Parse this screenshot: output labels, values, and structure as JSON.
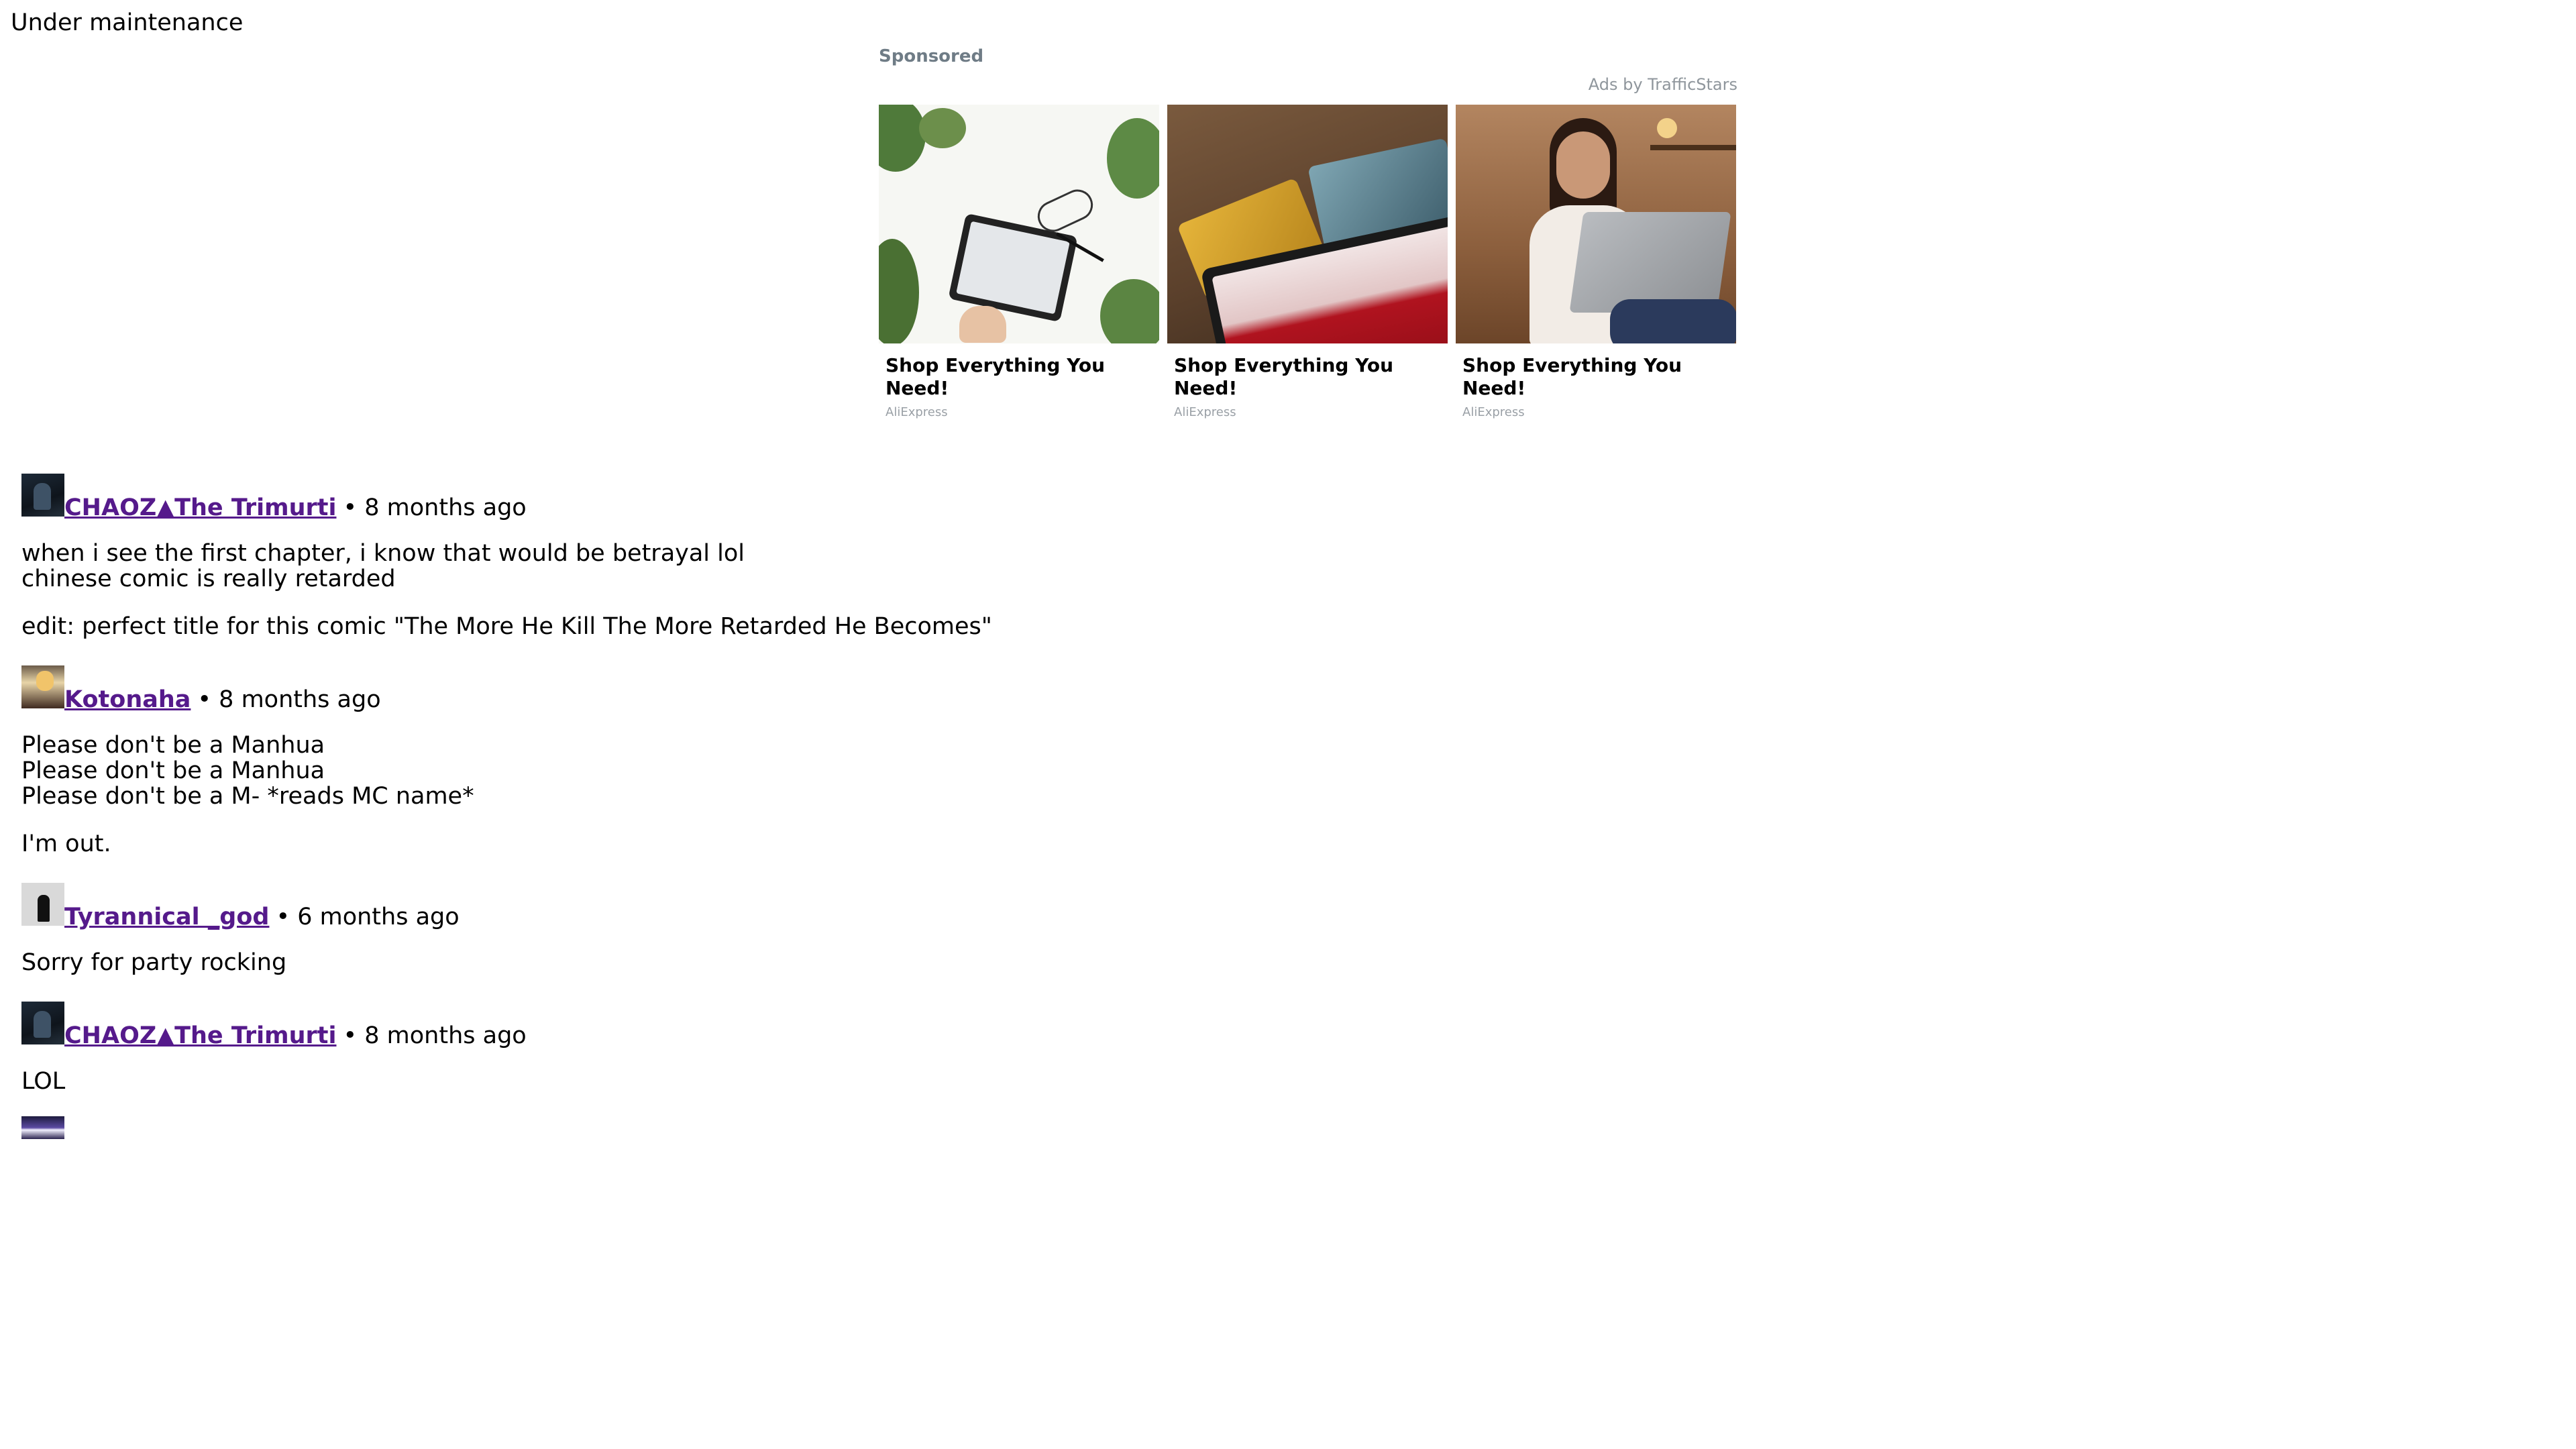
{
  "notice": "Under maintenance",
  "ads": {
    "sponsored_label": "Sponsored",
    "provider_label": "Ads by TrafficStars",
    "cards": [
      {
        "title": "Shop Everything You Need!",
        "source": "AliExpress"
      },
      {
        "title": "Shop Everything You Need!",
        "source": "AliExpress"
      },
      {
        "title": "Shop Everything You Need!",
        "source": "AliExpress"
      }
    ]
  },
  "comments": [
    {
      "author": "CHAOZ▲The Trimurti",
      "meta": "• 8 months ago",
      "paragraphs": [
        "when i see the first chapter, i know that would be betrayal lol\nchinese comic is really retarded",
        "edit: perfect title for this comic \"The More He Kill The More Retarded He Becomes\""
      ]
    },
    {
      "author": "Kotonaha",
      "meta": "• 8 months ago",
      "paragraphs": [
        "Please don't be a Manhua\nPlease don't be a Manhua\nPlease don't be a M- *reads MC name*",
        "I'm out."
      ]
    },
    {
      "author": "Tyrannical _god",
      "meta": "• 6 months ago",
      "paragraphs": [
        "Sorry for party rocking"
      ]
    },
    {
      "author": "CHAOZ▲The Trimurti",
      "meta": "• 8 months ago",
      "paragraphs": [
        "LOL"
      ]
    }
  ]
}
